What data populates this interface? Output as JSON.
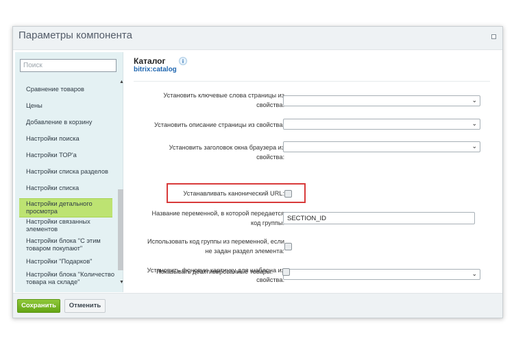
{
  "dialog": {
    "title": "Параметры компонента"
  },
  "sidebar": {
    "search_placeholder": "Поиск",
    "items": [
      {
        "label": "Сравнение товаров"
      },
      {
        "label": "Цены"
      },
      {
        "label": "Добавление в корзину"
      },
      {
        "label": "Настройки поиска"
      },
      {
        "label": "Настройки ТОР'а"
      },
      {
        "label": "Настройки списка разделов"
      },
      {
        "label": "Настройки списка"
      },
      {
        "label": "Настройки детального просмотра"
      },
      {
        "label": "Настройки связанных элементов"
      },
      {
        "label": "Настройки блока \"С этим товаром покупают\""
      },
      {
        "label": "Настройки \"Подарков\""
      },
      {
        "label": "Настройки блока \"Количество товара на складе\""
      }
    ],
    "active_index": 7
  },
  "main": {
    "title": "Каталог",
    "subtitle": "bitrix:catalog",
    "info_icon": "i",
    "params": [
      {
        "label": "Установить ключевые слова страницы из свойства:",
        "type": "select"
      },
      {
        "label": "Установить описание страницы из свойства:",
        "type": "select"
      },
      {
        "label": "Установить заголовок окна браузера из свойства:",
        "type": "select"
      },
      {
        "label": "Устанавливать канонический URL:",
        "type": "checkbox",
        "checked": false,
        "highlighted": true
      },
      {
        "label": "Название переменной, в которой передается код группы:",
        "type": "text",
        "value": "SECTION_ID"
      },
      {
        "label": "Использовать код группы из переменной, если не задан раздел элемента:",
        "type": "checkbox",
        "checked": false
      },
      {
        "label": "Установить фоновую картинку для шаблона из свойства:",
        "type": "select"
      },
      {
        "label": "Показывать деактивированные товары:",
        "type": "checkbox",
        "checked": false
      }
    ]
  },
  "footer": {
    "save_label": "Сохранить",
    "cancel_label": "Отменить"
  },
  "colors": {
    "active_item": "#bde372",
    "save_button": "#64a514",
    "highlight_border": "#d83a3a",
    "link": "#2067b0"
  }
}
